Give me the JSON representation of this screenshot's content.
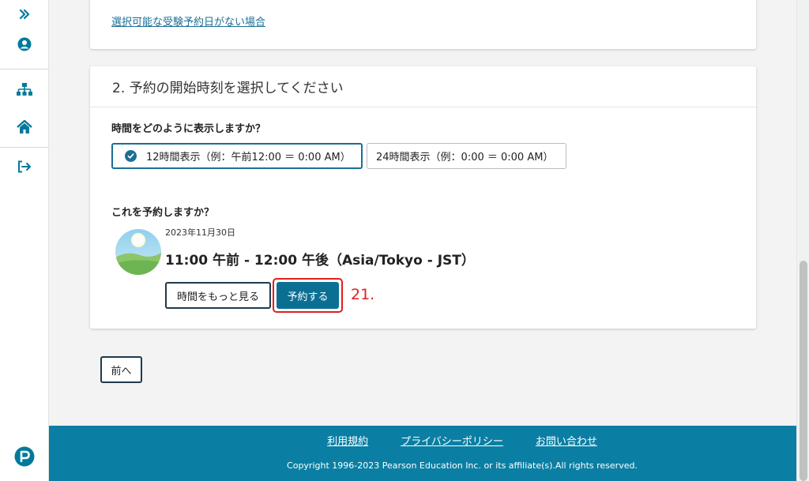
{
  "sidebar": {
    "items": [
      {
        "icon": "double-chevron-right-icon"
      },
      {
        "icon": "user-circle-icon"
      },
      {
        "icon": "sitemap-icon"
      },
      {
        "icon": "home-icon"
      },
      {
        "icon": "sign-out-icon"
      }
    ],
    "logo": "pearson-logo"
  },
  "top_card": {
    "link_text": "選択可能な受験予約日がない場合"
  },
  "section": {
    "title": "2. 予約の開始時刻を選択してください",
    "time_format_question": "時間をどのように表示しますか？",
    "options": [
      {
        "label": "12時間表示（例：午前12:00 ＝ 0:00 AM）",
        "selected": true
      },
      {
        "label": "24時間表示（例：0:00 ＝ 0:00 AM）",
        "selected": false
      }
    ],
    "booking_question": "これを予約しますか？",
    "slot": {
      "date": "2023年11月30日",
      "time": "11:00 午前 - 12:00 午後（Asia/Tokyo - JST）"
    },
    "more_times_label": "時間をもっと見る",
    "book_label": "予約する",
    "annotation": "21."
  },
  "nav": {
    "prev_label": "前へ"
  },
  "footer": {
    "links": [
      "利用規約",
      "プライバシーポリシー",
      "お問い合わせ"
    ],
    "copyright": "Copyright 1996-2023 Pearson Education Inc. or its affiliate(s).All rights reserved."
  },
  "colors": {
    "accent": "#0b7fa3",
    "primary_button": "#0b6f94",
    "highlight": "#e0201c"
  }
}
